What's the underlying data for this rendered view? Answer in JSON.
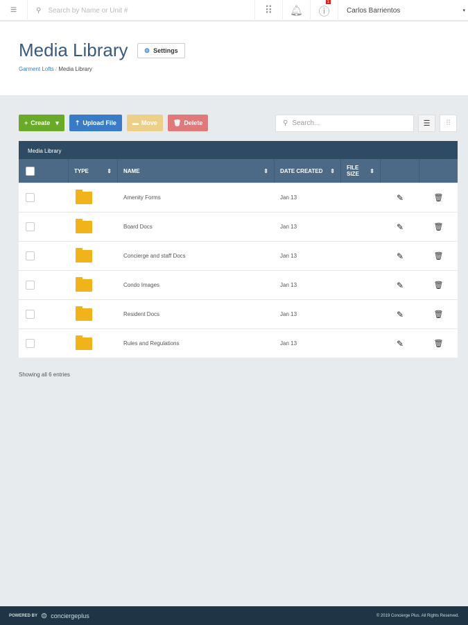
{
  "topbar": {
    "search_placeholder": "Search by Name or Unit #",
    "notification_count": "1",
    "user_name": "Carlos Barrientos"
  },
  "header": {
    "title": "Media Library",
    "settings_label": "Settings",
    "breadcrumb": [
      "Garment Lofts",
      "Media Library"
    ]
  },
  "toolbar": {
    "create": "Create",
    "upload": "Upload File",
    "move": "Move",
    "delete": "Delete",
    "search_placeholder": "Search..."
  },
  "colors": {
    "create": "#6aaa2a",
    "upload": "#3a7bc8",
    "move": "#ecd08a",
    "delete": "#e07a7a"
  },
  "table": {
    "caption": "Media Library",
    "columns": [
      "TYPE",
      "NAME",
      "DATE CREATED",
      "FILE SIZE"
    ],
    "rows": [
      {
        "name": "Amenity Forms",
        "date": "Jan 13"
      },
      {
        "name": "Board Docs",
        "date": "Jan 13"
      },
      {
        "name": "Concierge and staff Docs",
        "date": "Jan 13"
      },
      {
        "name": "Condo Images",
        "date": "Jan 13"
      },
      {
        "name": "Resident Docs",
        "date": "Jan 13"
      },
      {
        "name": "Rules and Regulations",
        "date": "Jan 13"
      }
    ]
  },
  "footnote": "Showing all 6 entries",
  "footer": {
    "powered_by": "POWERED BY",
    "brand": "conciergeplus",
    "copyright": "© 2019 Concierge Plus. All Rights Reserved."
  }
}
